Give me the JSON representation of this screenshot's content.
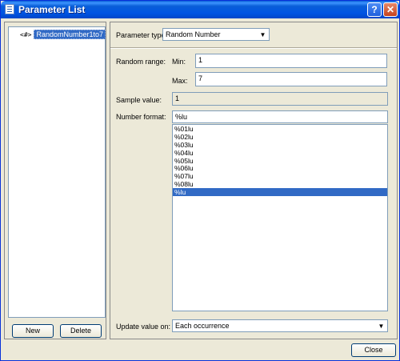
{
  "window": {
    "title": "Parameter List",
    "help_label": "?",
    "close_glyph": "✕"
  },
  "tree": {
    "icon_text": "<#>",
    "items": [
      {
        "label": "RandomNumber1to7"
      }
    ]
  },
  "left_buttons": {
    "new_label": "New",
    "delete_label": "Delete"
  },
  "parameter_type": {
    "label": "Parameter type:",
    "value": "Random Number"
  },
  "random_range": {
    "label": "Random range:",
    "min_label": "Min:",
    "min_value": "1",
    "max_label": "Max:",
    "max_value": "7"
  },
  "sample": {
    "label": "Sample value:",
    "value": "1"
  },
  "number_format": {
    "label": "Number format:",
    "value": "%lu",
    "options": [
      "%01lu",
      "%02lu",
      "%03lu",
      "%04lu",
      "%05lu",
      "%06lu",
      "%07lu",
      "%08lu",
      "%lu"
    ],
    "selected_index": 8
  },
  "update": {
    "label": "Update value on:",
    "value": "Each occurrence"
  },
  "footer": {
    "close_label": "Close"
  },
  "colors": {
    "titlebar": "#0054e3",
    "selection": "#316ac5",
    "face": "#ece9d8"
  }
}
